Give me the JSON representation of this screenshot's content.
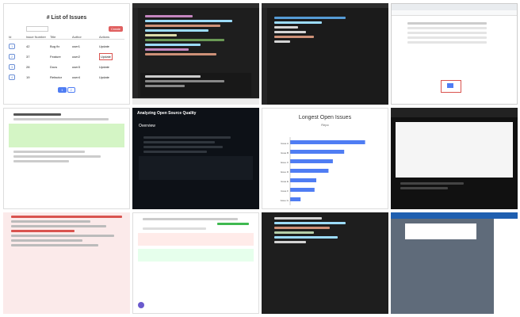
{
  "tiles": {
    "issues_list": {
      "title": "# List of Issues",
      "headers": [
        "Id",
        "Issue Number",
        "Title",
        "Author",
        "Actions"
      ],
      "new_button": "Create",
      "rows": [
        {
          "id": "1",
          "num": "42",
          "title": "Bug fix",
          "author": "user1",
          "action": "Update"
        },
        {
          "id": "2",
          "num": "37",
          "title": "Feature",
          "author": "user2",
          "action": "Update"
        },
        {
          "id": "3",
          "num": "28",
          "title": "Docs",
          "author": "user3",
          "action": "Update"
        },
        {
          "id": "4",
          "num": "19",
          "title": "Refactor",
          "author": "user4",
          "action": "Update"
        }
      ],
      "pagination": [
        "1",
        "2"
      ]
    },
    "longest_issues": {
      "title": "Longest Open Issues",
      "subtitle": "Repo",
      "bars": [
        {
          "label": "Issue A",
          "value": 0.86
        },
        {
          "label": "Issue B",
          "value": 0.62
        },
        {
          "label": "Issue C",
          "value": 0.49
        },
        {
          "label": "Issue D",
          "value": 0.44
        },
        {
          "label": "Issue E",
          "value": 0.3
        },
        {
          "label": "Issue F",
          "value": 0.28
        },
        {
          "label": "Issue G",
          "value": 0.12
        }
      ]
    },
    "github_readme": {
      "title": "Analyzing Open Source Quality",
      "section": "Overview"
    }
  },
  "colors": {
    "accent_blue": "#4f7df3",
    "dark_bg": "#1e1e1e",
    "red": "#d9534f",
    "green": "#3fb950",
    "purple": "#6a5acd"
  }
}
